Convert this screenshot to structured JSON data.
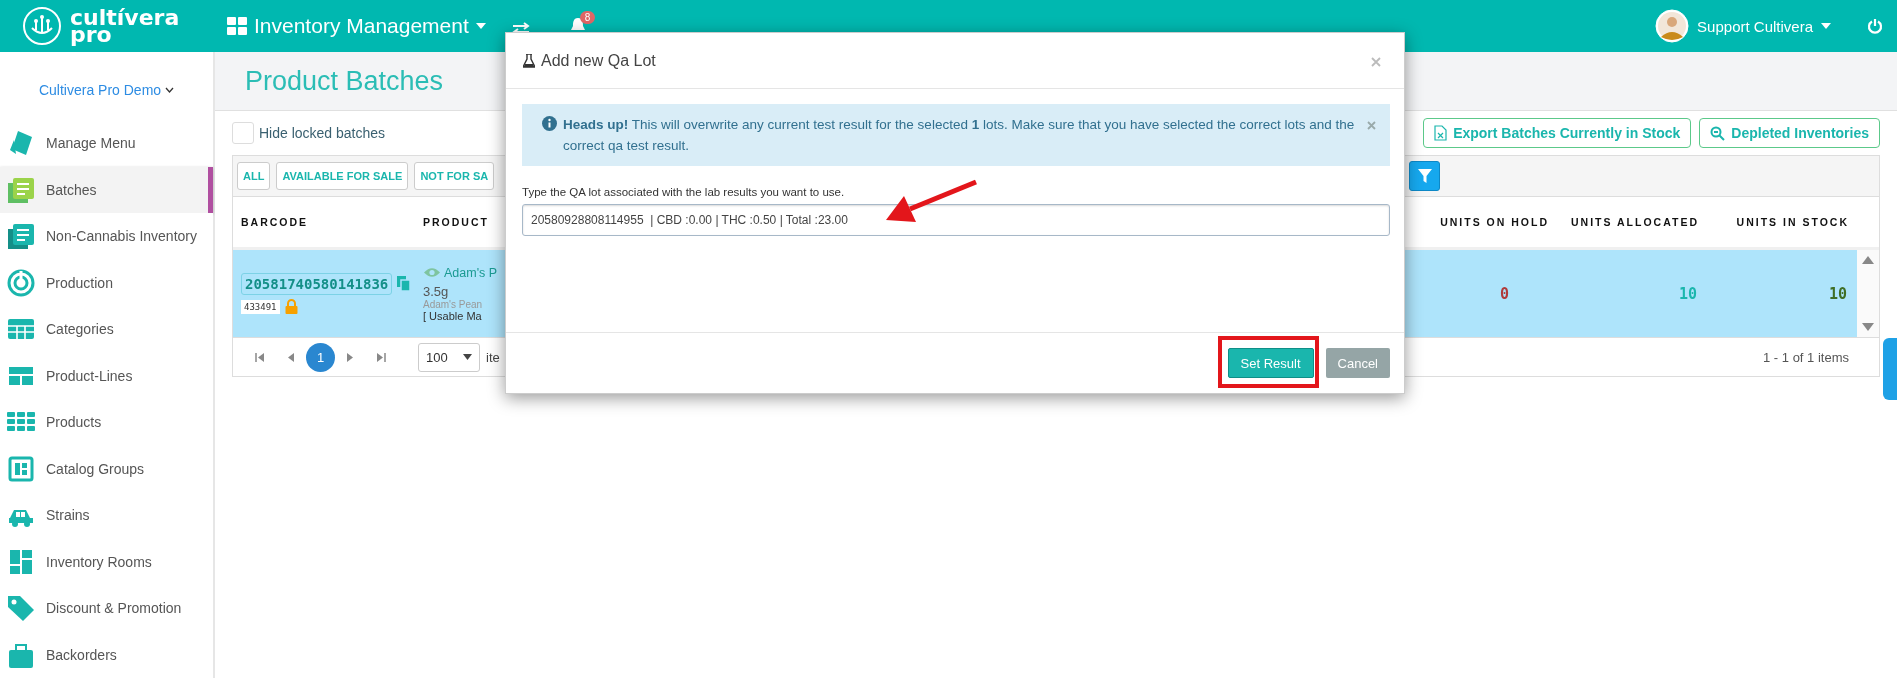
{
  "topbar": {
    "logo_line1": "cultívera",
    "logo_line2": "pro",
    "module": "Inventory Management",
    "notifications": "8",
    "user": "Support Cultivera"
  },
  "sidebar": {
    "account": "Cultivera Pro Demo",
    "items": [
      {
        "label": "Manage Menu",
        "selected": false
      },
      {
        "label": "Batches",
        "selected": true
      },
      {
        "label": "Non-Cannabis Inventory",
        "selected": false
      },
      {
        "label": "Production",
        "selected": false
      },
      {
        "label": "Categories",
        "selected": false
      },
      {
        "label": "Product-Lines",
        "selected": false
      },
      {
        "label": "Products",
        "selected": false
      },
      {
        "label": "Catalog Groups",
        "selected": false
      },
      {
        "label": "Strains",
        "selected": false
      },
      {
        "label": "Inventory Rooms",
        "selected": false
      },
      {
        "label": "Discount & Promotion",
        "selected": false
      },
      {
        "label": "Backorders",
        "selected": false
      }
    ]
  },
  "page": {
    "title": "Product Batches",
    "hide_locked": {
      "label": "Hide locked batches",
      "checked": false
    },
    "actions": [
      "Export Batches Currently in Stock",
      "Depleted Inventories"
    ],
    "filters": [
      "ALL",
      "AVAILABLE FOR SALE",
      "NOT FOR SA"
    ]
  },
  "table": {
    "columns": [
      "BARCODE",
      "PRODUCT",
      "UNITS ON HOLD",
      "UNITS ALLOCATED",
      "UNITS IN STOCK"
    ],
    "rows": [
      {
        "barcode": "20581740580141836",
        "tag": "433491",
        "locked": true,
        "selected": true,
        "product": "Adam's P",
        "size": "3.5g",
        "subtitle": "Adam's Pean",
        "category": "[ Usable Ma",
        "on_hold": "0",
        "allocated": "10",
        "in_stock": "10"
      }
    ]
  },
  "pagination": {
    "pages": [
      {
        "label": "1",
        "selected": true
      }
    ],
    "page_size": "100",
    "page_size_suffix": "ite",
    "summary": "1 - 1 of 1 items"
  },
  "modal": {
    "title": "Add new Qa Lot",
    "alert": "**Heads up!** This will overwrite any current test result for the selected **1** lots. Make sure that you have selected the correct lots and the correct qa test result.",
    "field_label": "Type the QA lot associated with the lab results you want to use.",
    "field_value": "20580928808114955  | CBD :0.00 | THC :0.50 | Total :23.00",
    "buttons": [
      {
        "label": "Set Result",
        "kind": "primary"
      },
      {
        "label": "Cancel",
        "kind": "secondary"
      }
    ]
  }
}
